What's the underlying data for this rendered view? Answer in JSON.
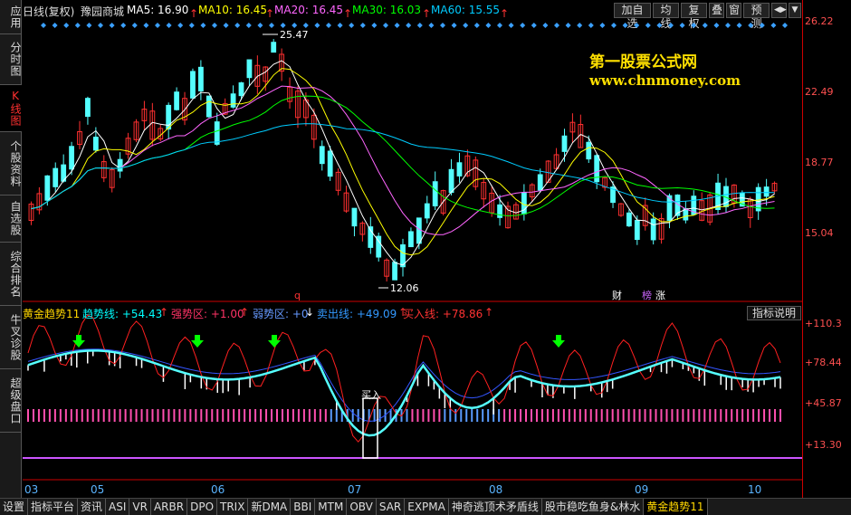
{
  "sidebar_tabs": [
    {
      "label": "应用",
      "active": false
    },
    {
      "label": "分时图",
      "active": false
    },
    {
      "label": "K线图",
      "active": true
    },
    {
      "label": "个股资料",
      "active": false
    },
    {
      "label": "自选股",
      "active": false
    },
    {
      "label": "综合排名",
      "active": false
    },
    {
      "label": "牛叉诊股",
      "active": false
    },
    {
      "label": "超级盘口",
      "active": false
    }
  ],
  "header": {
    "period": "日线(复权)",
    "stock": "豫园商城",
    "ma": [
      {
        "label": "MA5: 16.90",
        "color": "#ffffff"
      },
      {
        "label": "MA10: 16.45",
        "color": "#ffff00"
      },
      {
        "label": "MA20: 16.45",
        "color": "#ff66ff"
      },
      {
        "label": "MA30: 16.03",
        "color": "#00ff00"
      },
      {
        "label": "MA60: 15.55",
        "color": "#00ccff"
      }
    ],
    "buttons": [
      "加自选",
      "均线",
      "复权",
      "叠",
      "窗",
      "预测"
    ],
    "arrow_btn": "◀▶",
    "menu_btn": "▼"
  },
  "watermark": {
    "line1": "第一股票公式网",
    "line2": "www.chnmoney.com"
  },
  "price_axis": [
    "26.22",
    "22.49",
    "18.77",
    "15.04"
  ],
  "price_annot": {
    "high": "25.47",
    "low": "12.06",
    "q": "q",
    "cai": "财",
    "bang": "榜",
    "zhang": "涨"
  },
  "indicator": {
    "name": "黄金趋势11",
    "fields": [
      {
        "label": "趋势线: +54.43",
        "color": "#00ffff"
      },
      {
        "label": "强势区: +1.00",
        "color": "#ff3366"
      },
      {
        "label": "弱势区: +0",
        "color": "#6699ff"
      },
      {
        "label": "卖出线: +49.09",
        "color": "#3399ff"
      },
      {
        "label": "买入线: +78.86",
        "color": "#ff3030"
      }
    ],
    "explain_btn": "指标说明",
    "buy_label": "买入",
    "axis": [
      "+110.3",
      "+78.44",
      "+45.87",
      "+13.30"
    ]
  },
  "date_labels": [
    "03",
    "05",
    "06",
    "07",
    "08",
    "09",
    "10"
  ],
  "bottom_tabs": [
    "设置",
    "指标平台",
    "资讯",
    "ASI",
    "VR",
    "ARBR",
    "DPO",
    "TRIX",
    "新DMA",
    "BBI",
    "MTM",
    "OBV",
    "SAR",
    "EXPMA",
    "神奇逃顶术矛盾线",
    "股市稳吃鱼身&林水",
    "黄金趋势11"
  ],
  "bottom_active": "黄金趋势11"
}
